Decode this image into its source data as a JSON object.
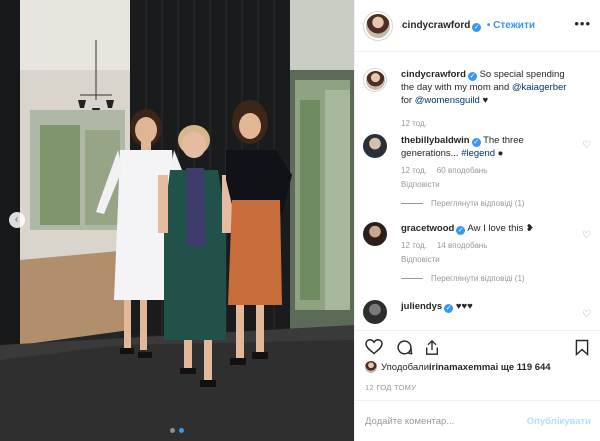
{
  "post": {
    "author": "cindycrawford",
    "follow_label": "Стежити",
    "more_glyph": "•••"
  },
  "caption": {
    "author": "cindycrawford",
    "text_before": " So special spending the day with my mom and ",
    "mention_1": "@kaiagerber",
    "text_middle": " for ",
    "mention_2": "@womensguild",
    "text_after": " ♥",
    "time": "12 тод."
  },
  "comments": [
    {
      "author": "thebillybaldwin",
      "text": " The three generations... ",
      "hashtag": "#legend",
      "emoji": " ●",
      "time": "12 тод.",
      "likes": "60 вподобань",
      "reply": "Відповісти",
      "view_replies": "Переглянути відповіді (1)"
    },
    {
      "author": "gracetwood",
      "text": " Aw I love this ",
      "emoji": "❥",
      "time": "12 тод.",
      "likes": "14 вподобань",
      "reply": "Відповісти",
      "view_replies": "Переглянути відповіді (1)"
    },
    {
      "author": "juliendys",
      "text": " ♥♥♥"
    }
  ],
  "likes_summary": {
    "prefix": "Уподобали ",
    "user": "irinamaxemma",
    "suffix": " і ще 119 644"
  },
  "posted_ago": "12 ГОД ТОМУ",
  "comment_box": {
    "placeholder": "Додайте коментар...",
    "publish_label": "Опублікувати"
  },
  "carousel": {
    "dots": 2,
    "active_index": 1
  },
  "colors": {
    "accent": "#3897f0",
    "link": "#003569",
    "muted": "#999999",
    "publish_disabled": "#b2dffc"
  },
  "icons": [
    "chevron-left-icon",
    "verified-badge-icon",
    "more-icon",
    "heart-icon",
    "comment-icon",
    "share-icon",
    "bookmark-icon"
  ]
}
